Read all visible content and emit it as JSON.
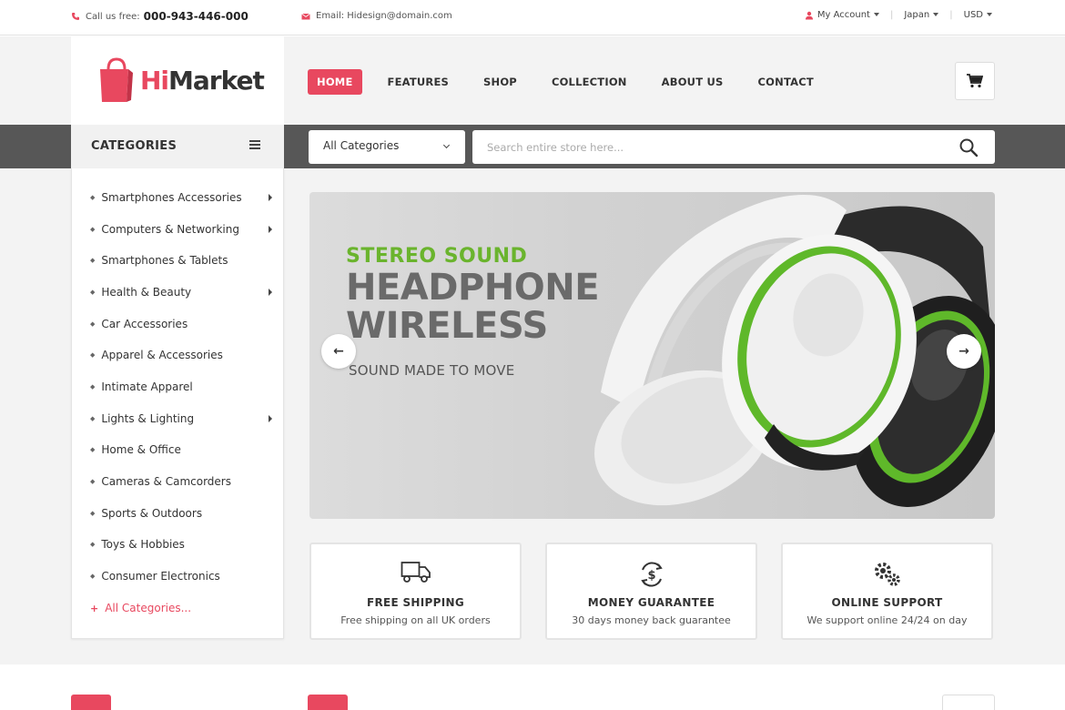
{
  "topbar": {
    "call_label": "Call us free:",
    "phone": "000-943-446-000",
    "email_label": "Email: Hidesign@domain.com",
    "account": "My Account",
    "language": "Japan",
    "currency": "USD"
  },
  "logo": {
    "hi": "Hi",
    "market": "Market"
  },
  "nav": {
    "items": [
      "HOME",
      "FEATURES",
      "SHOP",
      "COLLECTION",
      "ABOUT US",
      "CONTACT"
    ],
    "active": "HOME"
  },
  "categories": {
    "title": "CATEGORIES",
    "items": [
      {
        "label": "Smartphones Accessories",
        "has_sub": true
      },
      {
        "label": "Computers & Networking",
        "has_sub": true
      },
      {
        "label": "Smartphones & Tablets",
        "has_sub": false
      },
      {
        "label": "Health & Beauty",
        "has_sub": true
      },
      {
        "label": "Car Accessories",
        "has_sub": false
      },
      {
        "label": "Apparel & Accessories",
        "has_sub": false
      },
      {
        "label": "Intimate Apparel",
        "has_sub": false
      },
      {
        "label": "Lights & Lighting",
        "has_sub": true
      },
      {
        "label": "Home & Office",
        "has_sub": false
      },
      {
        "label": "Cameras & Camcorders",
        "has_sub": false
      },
      {
        "label": "Sports & Outdoors",
        "has_sub": false
      },
      {
        "label": "Toys & Hobbies",
        "has_sub": false
      },
      {
        "label": "Consumer Electronics",
        "has_sub": false
      }
    ],
    "all_label": "All Categories..."
  },
  "search": {
    "category_selected": "All Categories",
    "placeholder": "Search entire store here..."
  },
  "hero": {
    "line1": "STEREO SOUND",
    "line2": "HEADPHONE",
    "line3": "WIRELESS",
    "tagline": "SOUND MADE TO MOVE"
  },
  "features": [
    {
      "icon": "truck-icon",
      "title": "FREE SHIPPING",
      "subtitle": "Free shipping on all UK orders"
    },
    {
      "icon": "money-refresh-icon",
      "title": "MONEY GUARANTEE",
      "subtitle": "30 days money back guarantee"
    },
    {
      "icon": "gears-icon",
      "title": "ONLINE SUPPORT",
      "subtitle": "We support online 24/24 on day"
    }
  ],
  "colors": {
    "accent": "#e8485f",
    "green": "#6ab42d",
    "darkbar": "#575757"
  }
}
